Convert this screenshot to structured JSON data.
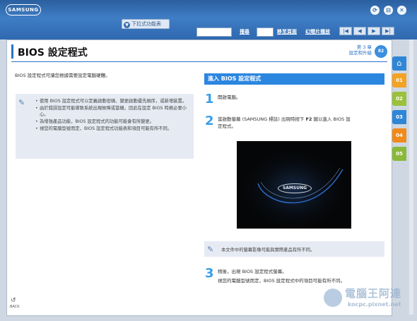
{
  "window": {
    "logo": "SAMSUNG",
    "buttons": [
      "⟳",
      "⊟",
      "✕"
    ]
  },
  "toolbar": {
    "dropdown_label": "下拉式功能表",
    "search_label": "搜尋",
    "goto_label": "移至頁面",
    "slideshow_label": "幻燈片播放",
    "page_buttons": [
      "|◀",
      "◀",
      "▶",
      "▶|"
    ]
  },
  "page": {
    "title": "BIOS 設定程式",
    "chapter_line1": "第 3 章",
    "chapter_line2": "設定和升級",
    "page_number": "82",
    "intro": "BIOS 設定程式可讓您根據需要設定電腦硬體。",
    "notes": [
      "使用 BIOS 設定程式可以定義啟動密碼、變更啟動優先順序，或新增裝置。",
      "由於錯誤設定可能導致系統出現故障或當機，因此在設定 BIOS 時務必要小心。",
      "為增強產品功能，BIOS 設定程式的功能可能會有所變更。",
      "視您的電腦型號而定，BIOS 設定程式功能表和項目可能有所不同。"
    ],
    "section_title": "進入 BIOS 設定程式",
    "steps": [
      {
        "num": "1",
        "text": "開啟電腦。"
      },
      {
        "num": "2",
        "text_a": "當啟動螢幕 (SAMSUNG 標誌) 出現時按下",
        "key": "F2",
        "text_b": "鍵以進入 BIOS 設",
        "text_c": "定程式。"
      },
      {
        "num": "3",
        "text": "稍後，出現 BIOS 設定程式螢幕。",
        "text2": "視您的電腦型號而定，BIOS 設定程式中的項目可能有所不同。"
      }
    ],
    "screenshot_logo": "SAMSUNG",
    "note2": "本文件中的螢幕影像可能與實際產品有所不同。",
    "refresh_label": "BACK"
  },
  "side_tabs": [
    {
      "label": "01",
      "color": "#f3a224"
    },
    {
      "label": "02",
      "color": "#9bc13c"
    },
    {
      "label": "03",
      "color": "#2f86d6"
    },
    {
      "label": "04",
      "color": "#f08a1c"
    },
    {
      "label": "05",
      "color": "#8ab83a"
    }
  ],
  "watermark": {
    "line1": "電腦王阿達",
    "line2": "kocpc.pixnet.net"
  }
}
